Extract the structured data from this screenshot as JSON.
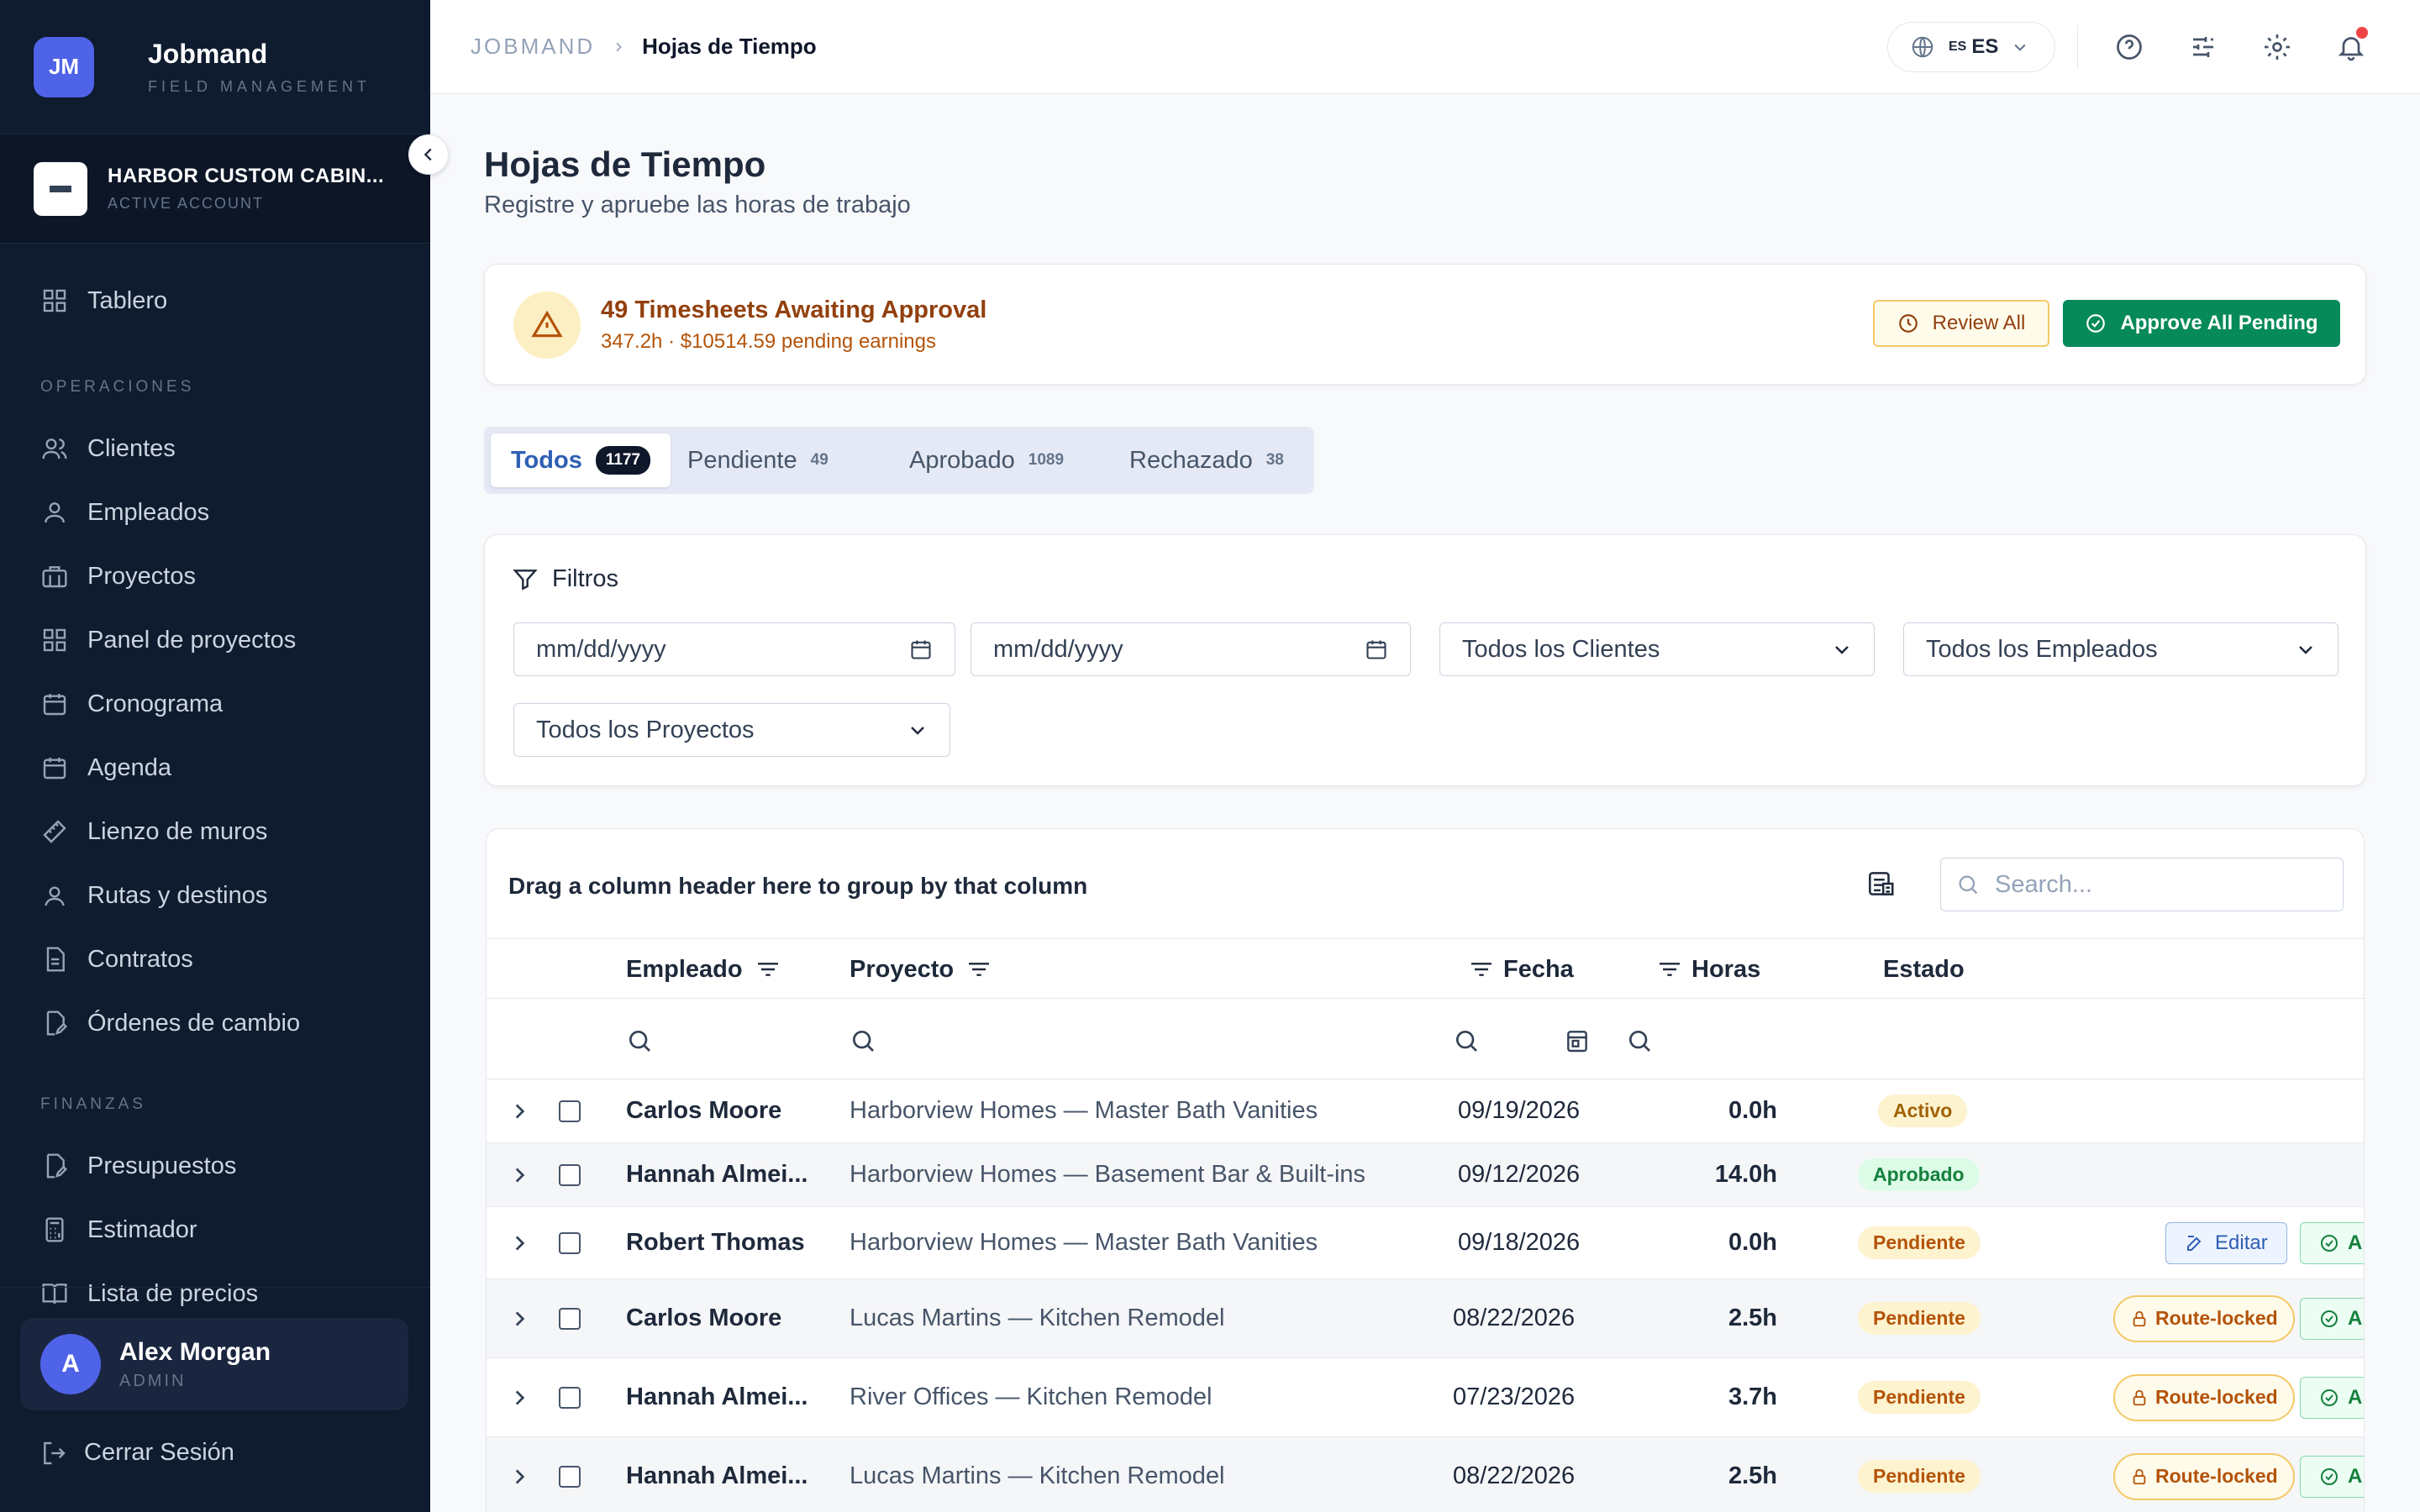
{
  "brand": {
    "initials": "JM",
    "name": "Jobmand",
    "subtitle": "FIELD MANAGEMENT"
  },
  "account": {
    "name": "HARBOR CUSTOM CABIN...",
    "status": "ACTIVE ACCOUNT"
  },
  "nav": {
    "top": [
      {
        "label": "Tablero",
        "icon": "grid-icon"
      }
    ],
    "section_ops": "OPERACIONES",
    "ops": [
      {
        "label": "Clientes",
        "icon": "users-icon"
      },
      {
        "label": "Empleados",
        "icon": "user-icon"
      },
      {
        "label": "Proyectos",
        "icon": "building-icon"
      },
      {
        "label": "Panel de proyectos",
        "icon": "grid-icon"
      },
      {
        "label": "Cronograma",
        "icon": "calendar-icon"
      },
      {
        "label": "Agenda",
        "icon": "calendar-icon"
      },
      {
        "label": "Lienzo de muros",
        "icon": "ruler-icon"
      },
      {
        "label": "Rutas y destinos",
        "icon": "map-pin-icon"
      },
      {
        "label": "Contratos",
        "icon": "file-icon"
      },
      {
        "label": "Órdenes de cambio",
        "icon": "file-edit-icon"
      }
    ],
    "section_fin": "FINANZAS",
    "fin": [
      {
        "label": "Presupuestos",
        "icon": "file-edit-icon"
      },
      {
        "label": "Estimador",
        "icon": "calculator-icon"
      },
      {
        "label": "Lista de precios",
        "icon": "book-icon"
      }
    ]
  },
  "user": {
    "initial": "A",
    "name": "Alex Morgan",
    "role": "ADMIN"
  },
  "logout_label": "Cerrar Sesión",
  "breadcrumb": {
    "root": "JOBMAND",
    "current": "Hojas de Tiempo"
  },
  "language": {
    "flag": "ES",
    "code": "ES"
  },
  "page": {
    "title": "Hojas de Tiempo",
    "subtitle": "Registre y apruebe las horas de trabajo"
  },
  "alert": {
    "title": "49 Timesheets Awaiting Approval",
    "subtitle": "347.2h · $10514.59 pending earnings",
    "review_label": "Review All",
    "approve_label": "Approve All Pending"
  },
  "tabs": [
    {
      "label": "Todos",
      "count": "1177",
      "active": true
    },
    {
      "label": "Pendiente",
      "count": "49"
    },
    {
      "label": "Aprobado",
      "count": "1089"
    },
    {
      "label": "Rechazado",
      "count": "38"
    }
  ],
  "filters": {
    "title": "Filtros",
    "date_from": "mm/dd/yyyy",
    "date_to": "mm/dd/yyyy",
    "clients": "Todos los Clientes",
    "employees": "Todos los Empleados",
    "projects": "Todos los Proyectos"
  },
  "grid": {
    "group_hint": "Drag a column header here to group by that column",
    "search_placeholder": "Search...",
    "columns": {
      "employee": "Empleado",
      "project": "Proyecto",
      "date": "Fecha",
      "hours": "Horas",
      "status": "Estado"
    },
    "rows": [
      {
        "employee": "Carlos Moore",
        "project": "Harborview Homes — Master Bath Vanities",
        "date": "09/19/2026",
        "hours": "0.0h",
        "status": "Activo",
        "status_kind": "activo",
        "action": "none"
      },
      {
        "employee": "Hannah Almei...",
        "project": "Harborview Homes — Basement Bar & Built-ins",
        "date": "09/12/2026",
        "hours": "14.0h",
        "status": "Aprobado",
        "status_kind": "aprobado",
        "action": "none"
      },
      {
        "employee": "Robert Thomas",
        "project": "Harborview Homes — Master Bath Vanities",
        "date": "09/18/2026",
        "hours": "0.0h",
        "status": "Pendiente",
        "status_kind": "pendiente",
        "action": "edit",
        "action_label": "Editar",
        "approve_label": "A"
      },
      {
        "employee": "Carlos Moore",
        "project": "Lucas Martins — Kitchen Remodel",
        "date": "08/22/2026",
        "hours": "2.5h",
        "status": "Pendiente",
        "status_kind": "pendiente",
        "action": "locked",
        "action_label": "Route-locked",
        "approve_label": "A"
      },
      {
        "employee": "Hannah Almei...",
        "project": "River Offices — Kitchen Remodel",
        "date": "07/23/2026",
        "hours": "3.7h",
        "status": "Pendiente",
        "status_kind": "pendiente",
        "action": "locked",
        "action_label": "Route-locked",
        "approve_label": "A"
      },
      {
        "employee": "Hannah Almei...",
        "project": "Lucas Martins — Kitchen Remodel",
        "date": "08/22/2026",
        "hours": "2.5h",
        "status": "Pendiente",
        "status_kind": "pendiente",
        "action": "locked",
        "action_label": "Route-locked",
        "approve_label": "A"
      }
    ]
  },
  "colors": {
    "sidebar_bg": "#0f1b2e",
    "accent": "#4f63e8",
    "approve_green": "#078a5a",
    "warning": "#92400e",
    "notification_dot": "#ef4444"
  }
}
